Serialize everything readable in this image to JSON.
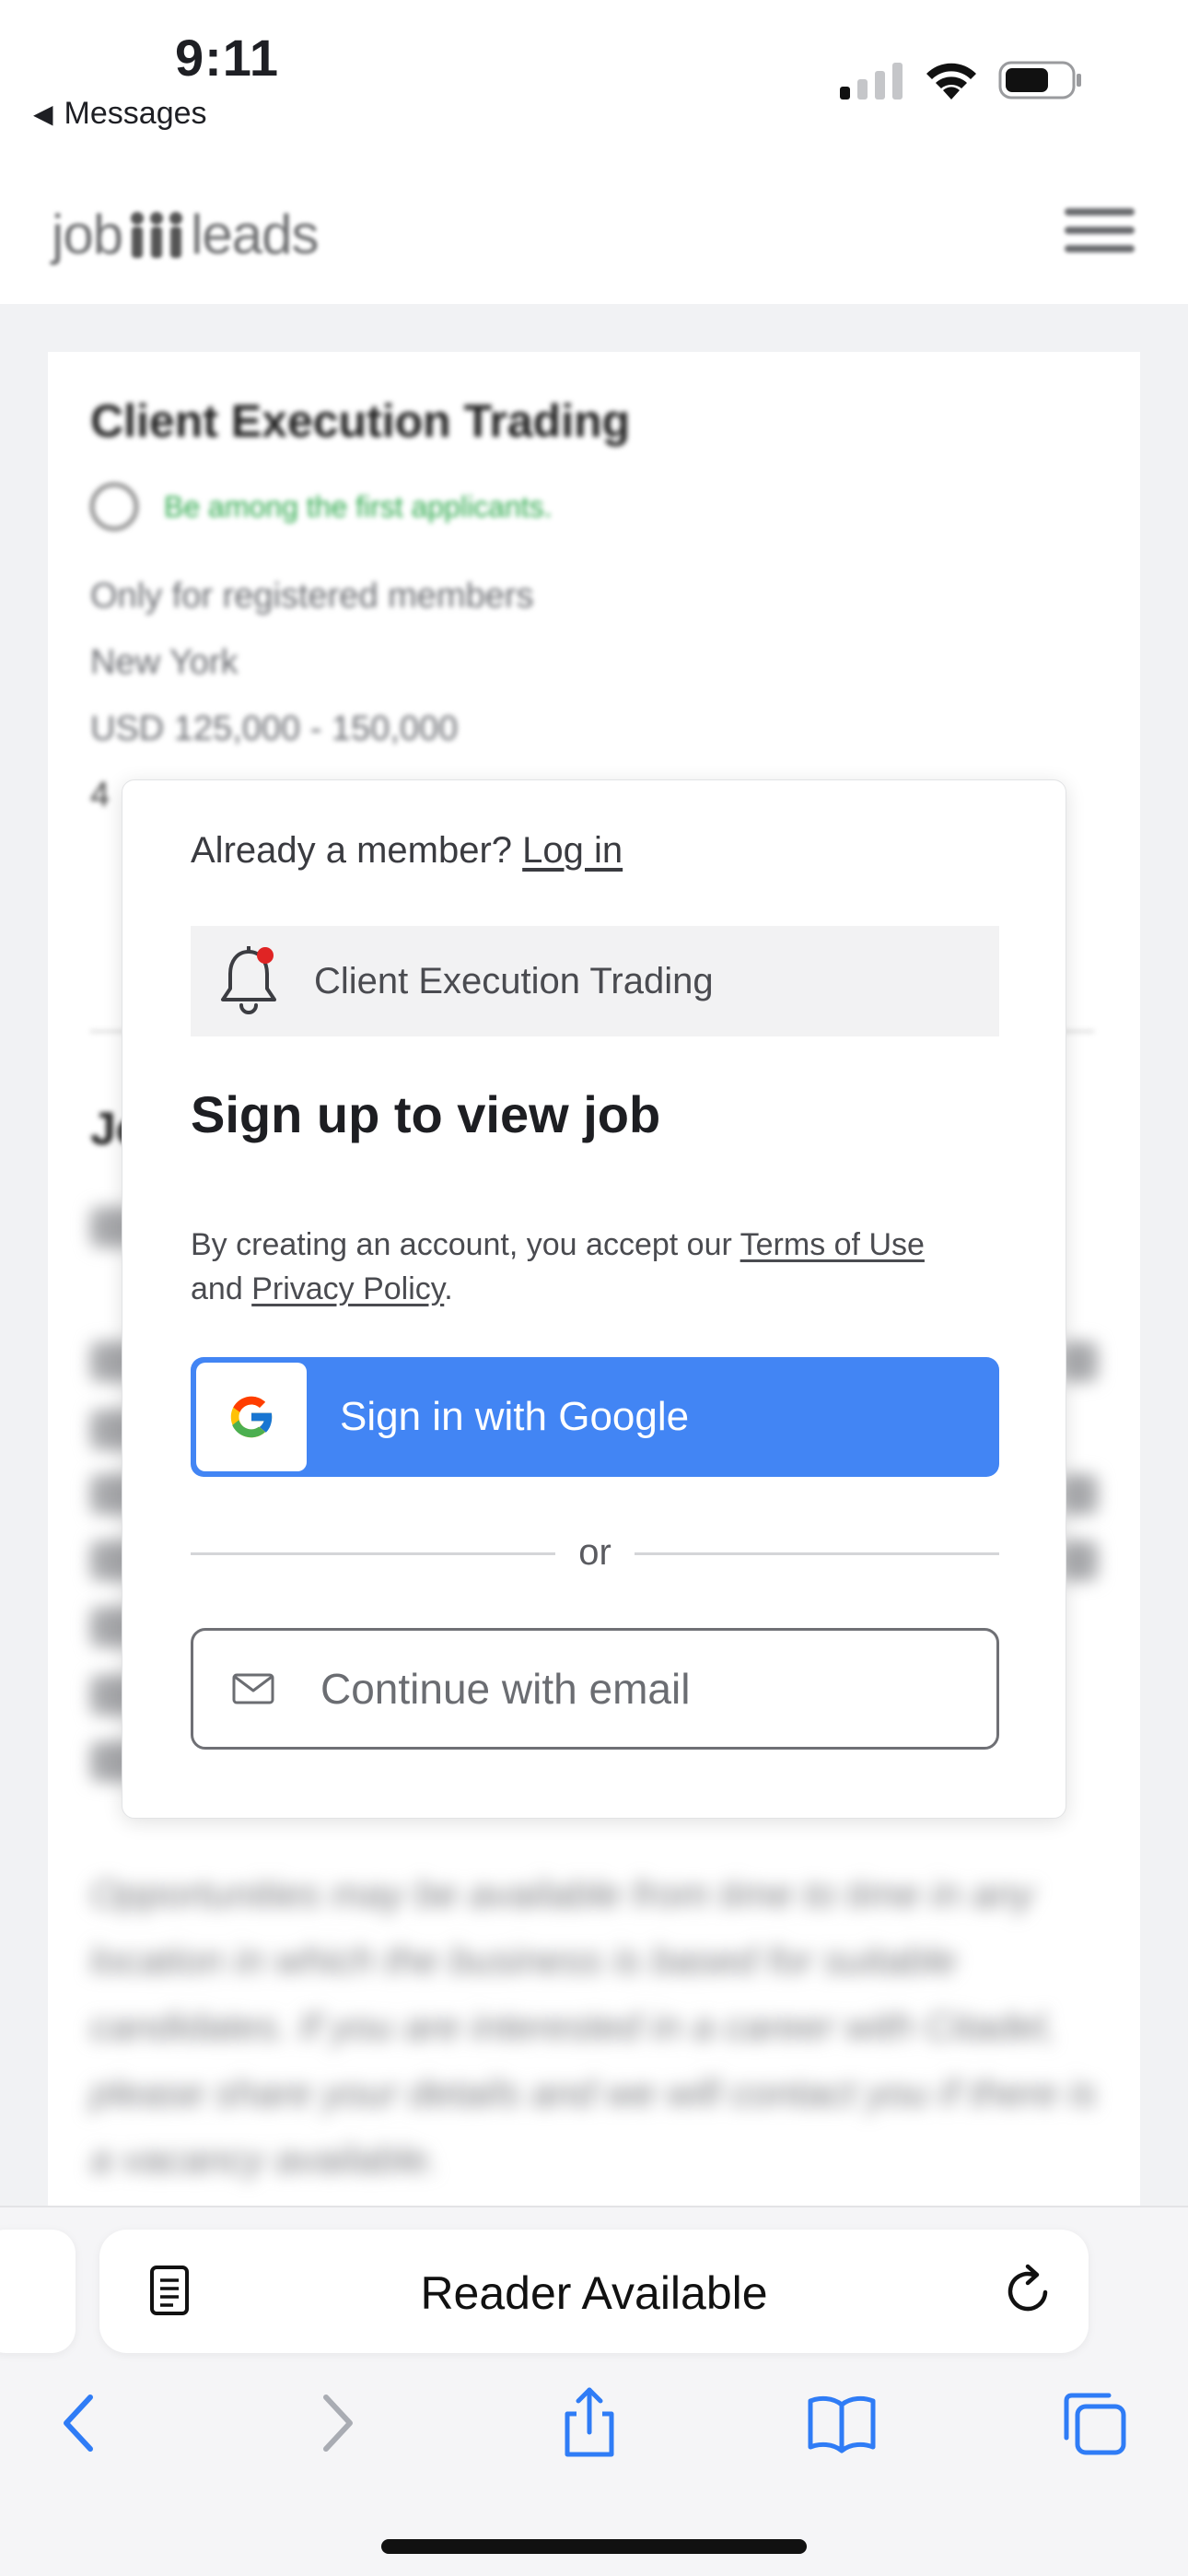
{
  "status_bar": {
    "time": "9:11",
    "back_label": "Messages",
    "back_glyph": "◀",
    "icons": [
      "signal-icon",
      "wifi-icon",
      "battery-icon"
    ]
  },
  "site": {
    "logo_left": "job",
    "logo_right": "leads"
  },
  "background_job": {
    "title": "Client Execution Trading",
    "fresh_note": "Be among the first applicants.",
    "membership": "Only for registered members",
    "location": "New York",
    "salary": "USD 125,000 - 150,000",
    "extra_fragment": "4",
    "section_fragment": "Jo",
    "italic_paragraph": "Opportunities may be available from time to time in any location in which the business is based for suitable candidates. If you are interested in a career with Citadel, please share your details and we will contact you if there is a vacancy available."
  },
  "modal": {
    "already_member": "Already a member?",
    "login_link": "Log in",
    "job_name": "Client Execution Trading",
    "heading": "Sign up to view job",
    "terms_prefix": "By creating an account, you accept our",
    "terms_link": "Terms of Use",
    "terms_and": "and",
    "privacy_link": "Privacy Policy",
    "terms_period": ".",
    "google_button": "Sign in with Google",
    "or_separator": "or",
    "email_button": "Continue with email",
    "colors": {
      "google_blue": "#4285f4",
      "notification_dot": "#e02424"
    }
  },
  "safari": {
    "reader_label": "Reader Available",
    "tint": "#2f7cf6",
    "disabled": "#a9acb3"
  }
}
